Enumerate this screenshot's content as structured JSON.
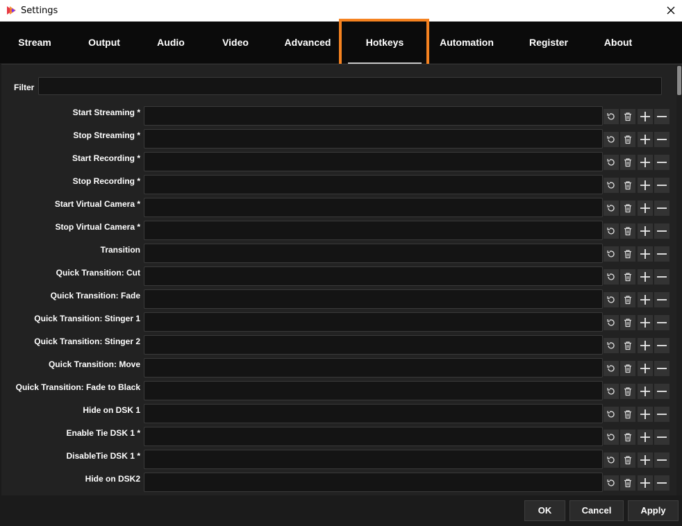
{
  "window": {
    "title": "Settings"
  },
  "tabs": [
    "Stream",
    "Output",
    "Audio",
    "Video",
    "Advanced",
    "Hotkeys",
    "Automation",
    "Register",
    "About"
  ],
  "active_tab": "Hotkeys",
  "filter": {
    "label": "Filter",
    "value": ""
  },
  "hotkeys": [
    {
      "label": "Start Streaming *",
      "value": ""
    },
    {
      "label": "Stop Streaming *",
      "value": ""
    },
    {
      "label": "Start Recording *",
      "value": ""
    },
    {
      "label": "Stop Recording *",
      "value": ""
    },
    {
      "label": "Start Virtual Camera *",
      "value": ""
    },
    {
      "label": "Stop Virtual Camera *",
      "value": ""
    },
    {
      "label": "Transition",
      "value": ""
    },
    {
      "label": "Quick Transition: Cut",
      "value": ""
    },
    {
      "label": "Quick Transition: Fade",
      "value": ""
    },
    {
      "label": "Quick Transition: Stinger 1",
      "value": ""
    },
    {
      "label": "Quick Transition: Stinger 2",
      "value": ""
    },
    {
      "label": "Quick Transition: Move",
      "value": ""
    },
    {
      "label": "Quick Transition: Fade to Black",
      "value": ""
    },
    {
      "label": "Hide on DSK 1",
      "value": ""
    },
    {
      "label": "Enable Tie DSK 1 *",
      "value": ""
    },
    {
      "label": "DisableTie DSK 1 *",
      "value": ""
    },
    {
      "label": "Hide on DSK2",
      "value": ""
    }
  ],
  "row_icons": [
    "revert-icon",
    "trash-icon",
    "plus-icon",
    "minus-icon"
  ],
  "footer": {
    "ok": "OK",
    "cancel": "Cancel",
    "apply": "Apply"
  },
  "colors": {
    "highlight": "#f58220",
    "background": "#1b1b1b",
    "tabbar": "#0b0b0b"
  }
}
